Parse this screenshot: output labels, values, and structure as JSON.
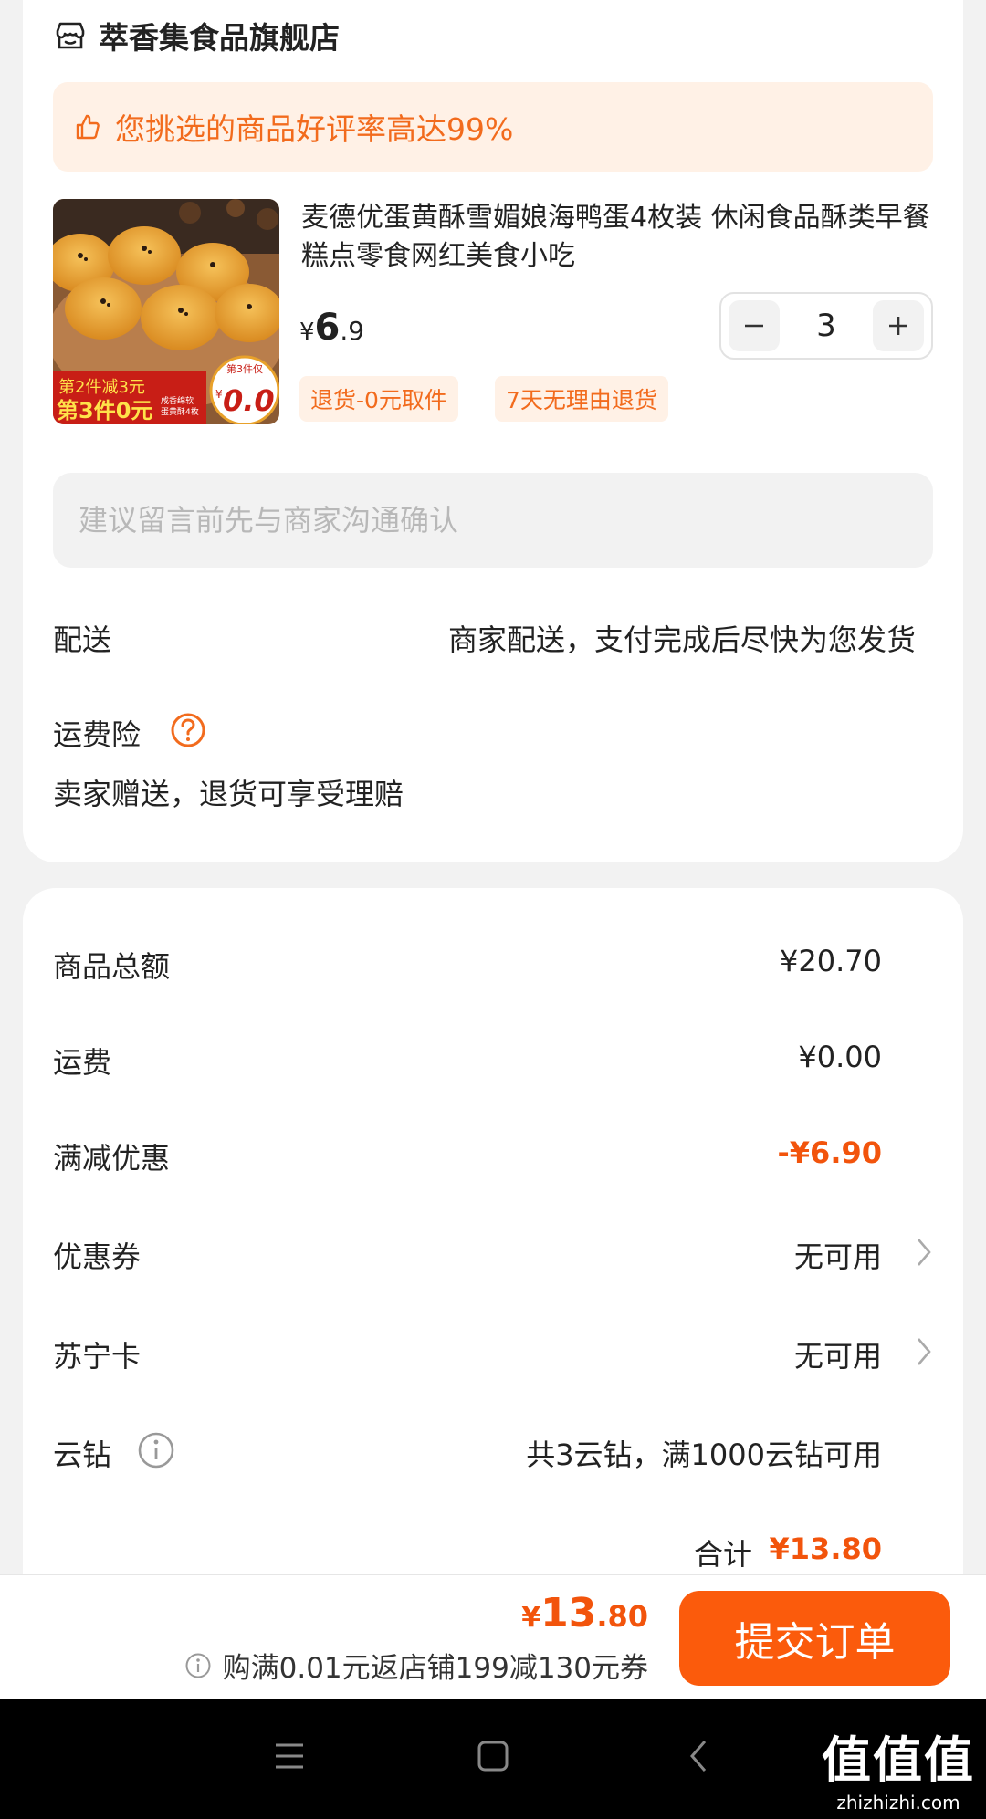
{
  "store": {
    "name": "萃香集食品旗舰店",
    "icon": "store-icon"
  },
  "rating_banner": {
    "text": "您挑选的商品好评率高达99%",
    "icon": "thumbs-up-icon"
  },
  "product": {
    "title": "麦德优蛋黄酥雪媚娘海鸭蛋4枚装 休闲食品酥类早餐糕点零食网红美食小吃",
    "price_currency": "¥",
    "price_int": "6",
    "price_dec": ".9",
    "quantity": "3",
    "image_promo_line1": "第2件减3元",
    "image_promo_line2": "第3件0元",
    "image_promo_small1": "咸香绵软",
    "image_promo_small2": "蛋黄酥4枚",
    "image_badge_top": "第3件仅",
    "image_badge_currency": "¥",
    "image_badge_price": "0.0",
    "tags": [
      "退货-0元取件",
      "7天无理由退货"
    ]
  },
  "remark": {
    "placeholder": "建议留言前先与商家沟通确认"
  },
  "delivery": {
    "label": "配送",
    "value": "商家配送，支付完成后尽快为您发货"
  },
  "insurance": {
    "label": "运费险",
    "desc": "卖家赠送，退货可享受理赔"
  },
  "summary": {
    "goods_total": {
      "label": "商品总额",
      "value": "¥20.70"
    },
    "shipping": {
      "label": "运费",
      "value": "¥0.00"
    },
    "discount": {
      "label": "满减优惠",
      "value": "-¥6.90"
    },
    "coupon": {
      "label": "优惠券",
      "value": "无可用"
    },
    "suning_card": {
      "label": "苏宁卡",
      "value": "无可用"
    },
    "cloud_diamond": {
      "label": "云钻",
      "value": "共3云钻，满1000云钻可用"
    },
    "subtotal": {
      "label": "合计",
      "value": "¥13.80"
    }
  },
  "bottom_bar": {
    "currency": "¥",
    "total_int": "13",
    "total_dec": ".80",
    "promo_text": "购满0.01元返店铺199减130元券",
    "submit_label": "提交订单"
  },
  "watermark": {
    "big": "值值值",
    "small": "zhizhizhi.com"
  },
  "colors": {
    "accent": "#fb5b0c",
    "price_red": "#f2540c",
    "tag_bg": "#fff1e6"
  }
}
